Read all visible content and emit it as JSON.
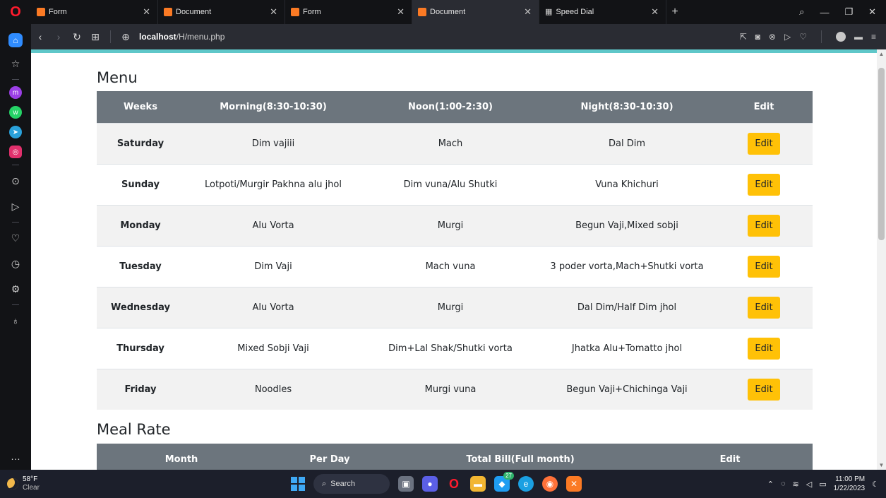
{
  "browser": {
    "tabs": [
      {
        "label": "Form",
        "icon": "xampp-icon"
      },
      {
        "label": "Document",
        "icon": "xampp-icon"
      },
      {
        "label": "Form",
        "icon": "xampp-icon"
      },
      {
        "label": "Document",
        "icon": "xampp-icon",
        "active": true
      },
      {
        "label": "Speed Dial",
        "icon": "grid-icon"
      }
    ],
    "url_host": "localhost",
    "url_path": "/H/menu.php"
  },
  "page": {
    "menu_title": "Menu",
    "menu_headers": [
      "Weeks",
      "Morning(8:30-10:30)",
      "Noon(1:00-2:30)",
      "Night(8:30-10:30)",
      "Edit"
    ],
    "menu_rows": [
      {
        "day": "Saturday",
        "morning": "Dim vajiii",
        "noon": "Mach",
        "night": "Dal Dim",
        "edit": "Edit"
      },
      {
        "day": "Sunday",
        "morning": "Lotpoti/Murgir Pakhna alu jhol",
        "noon": "Dim vuna/Alu Shutki",
        "night": "Vuna Khichuri",
        "edit": "Edit"
      },
      {
        "day": "Monday",
        "morning": "Alu Vorta",
        "noon": "Murgi",
        "night": "Begun Vaji,Mixed sobji",
        "edit": "Edit"
      },
      {
        "day": "Tuesday",
        "morning": "Dim Vaji",
        "noon": "Mach vuna",
        "night": "3 poder vorta,Mach+Shutki vorta",
        "edit": "Edit"
      },
      {
        "day": "Wednesday",
        "morning": "Alu Vorta",
        "noon": "Murgi",
        "night": "Dal Dim/Half Dim jhol",
        "edit": "Edit"
      },
      {
        "day": "Thursday",
        "morning": "Mixed Sobji Vaji",
        "noon": "Dim+Lal Shak/Shutki vorta",
        "night": "Jhatka Alu+Tomatto jhol",
        "edit": "Edit"
      },
      {
        "day": "Friday",
        "morning": "Noodles",
        "noon": "Murgi vuna",
        "night": "Begun Vaji+Chichinga Vaji",
        "edit": "Edit"
      }
    ],
    "meal_rate_title": "Meal Rate",
    "meal_rate_headers": [
      "Month",
      "Per Day",
      "Total Bill(Full month)",
      "Edit"
    ]
  },
  "taskbar": {
    "temperature": "58°F",
    "condition": "Clear",
    "search_label": "Search",
    "time": "11:00 PM",
    "date": "1/22/2023",
    "badge_count": "27"
  },
  "colors": {
    "table_header": "#6c757d",
    "edit_button": "#ffc107",
    "accent_line": "#5fc7c9"
  }
}
